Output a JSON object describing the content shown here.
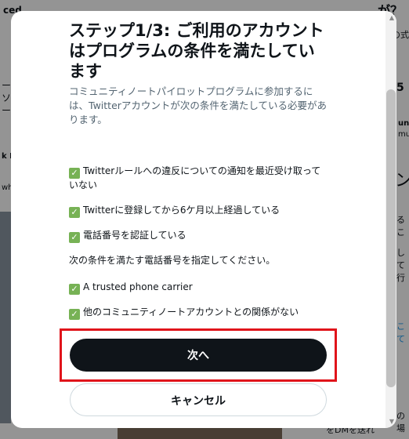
{
  "background": {
    "fragments": [
      {
        "id": "frag-1",
        "text": "ced"
      },
      {
        "id": "frag-2",
        "text": "が？"
      },
      {
        "id": "frag-3",
        "text": "「"
      },
      {
        "id": "frag-4",
        "text": "ー"
      },
      {
        "id": "frag-5",
        "text": "ソ"
      },
      {
        "id": "frag-6",
        "text": "ー"
      },
      {
        "id": "frag-7",
        "text": "の式"
      },
      {
        "id": "frag-8",
        "text": "5"
      },
      {
        "id": "frag-9",
        "text": "unit"
      },
      {
        "id": "frag-10",
        "text": "mun"
      },
      {
        "id": "frag-11",
        "text": "k Po"
      },
      {
        "id": "frag-12",
        "text": "who"
      },
      {
        "id": "frag-13",
        "text": "ン"
      },
      {
        "id": "frag-14",
        "text": "るこ"
      },
      {
        "id": "frag-15",
        "text": "して行"
      },
      {
        "id": "frag-16",
        "text": "こて"
      },
      {
        "id": "frag-17",
        "text": "の場"
      },
      {
        "id": "frag-18",
        "text": "をDMを送れ"
      }
    ]
  },
  "modal": {
    "title": "ステップ1/3: ご利用のアカウントはプログラムの条件を満たしています",
    "description": "コミュニティノートパイロットプログラムに参加するには、Twitterアカウントが次の条件を満たしている必要があります。",
    "check_glyph": "✓",
    "requirements": [
      {
        "text": "Twitterルールへの違反についての通知を最近受け取っていない"
      },
      {
        "text": "Twitterに登録してから6ケ月以上経過している"
      },
      {
        "text": "電話番号を認証している"
      }
    ],
    "phone_subhead": "次の条件を満たす電話番号を指定してください。",
    "phone_requirements": [
      {
        "text": "A trusted phone carrier"
      },
      {
        "text": "他のコミュニティノートアカウントとの関係がない"
      }
    ],
    "next_label": "次へ",
    "cancel_label": "キャンセル"
  }
}
